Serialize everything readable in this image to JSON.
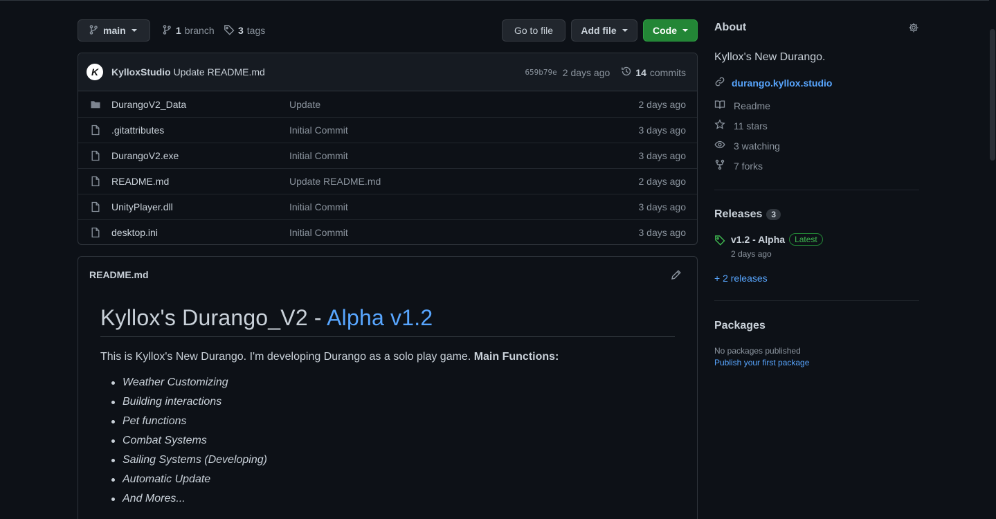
{
  "toolbar": {
    "branch_name": "main",
    "branches_count": "1",
    "branches_label": "branch",
    "tags_count": "3",
    "tags_label": "tags",
    "goto_file": "Go to file",
    "add_file": "Add file",
    "code": "Code"
  },
  "commit": {
    "avatar_letter": "K",
    "author": "KylloxStudio",
    "message": "Update README.md",
    "sha": "659b79e",
    "age": "2 days ago",
    "count": "14",
    "count_label": "commits"
  },
  "files": [
    {
      "name": "DurangoV2_Data",
      "type": "folder",
      "message": "Update",
      "age": "2 days ago"
    },
    {
      "name": ".gitattributes",
      "type": "file",
      "message": "Initial Commit",
      "age": "3 days ago"
    },
    {
      "name": "DurangoV2.exe",
      "type": "file",
      "message": "Initial Commit",
      "age": "3 days ago"
    },
    {
      "name": "README.md",
      "type": "file",
      "message": "Update README.md",
      "age": "2 days ago"
    },
    {
      "name": "UnityPlayer.dll",
      "type": "file",
      "message": "Initial Commit",
      "age": "3 days ago"
    },
    {
      "name": "desktop.ini",
      "type": "file",
      "message": "Initial Commit",
      "age": "3 days ago"
    }
  ],
  "readme": {
    "filename": "README.md",
    "h1_main": "Kyllox's Durango_V2 - ",
    "h1_accent": "Alpha v1.2",
    "intro": "This is Kyllox's New Durango. I'm developing Durango as a solo play game. ",
    "intro_bold": "Main Functions:",
    "items": [
      "Weather Customizing",
      "Building interactions",
      "Pet functions",
      "Combat Systems",
      "Sailing Systems (Developing)",
      "Automatic Update",
      "And Mores..."
    ]
  },
  "about": {
    "heading": "About",
    "description": "Kyllox's New Durango.",
    "homepage": "durango.kyllox.studio",
    "readme": "Readme",
    "stars": "11 stars",
    "watching": "3 watching",
    "forks": "7 forks"
  },
  "releases": {
    "heading": "Releases",
    "count": "3",
    "latest_name": "v1.2 - Alpha",
    "latest_badge": "Latest",
    "latest_date": "2 days ago",
    "more": "+ 2 releases"
  },
  "packages": {
    "heading": "Packages",
    "empty": "No packages published",
    "publish_link": "Publish your first package"
  },
  "colors": {
    "background": "#0d1117",
    "border": "#30363d",
    "accent_link": "#58a6ff",
    "code_button": "#238636",
    "latest_green": "#3fb950"
  },
  "icons": {
    "branch": "git-branch-icon",
    "tag": "tag-icon",
    "history": "history-icon",
    "folder": "folder-icon",
    "file": "file-icon",
    "pencil": "pencil-icon",
    "gear": "gear-icon",
    "link": "link-icon",
    "book": "book-icon",
    "star": "star-icon",
    "eye": "eye-icon",
    "fork": "repo-forked-icon"
  }
}
